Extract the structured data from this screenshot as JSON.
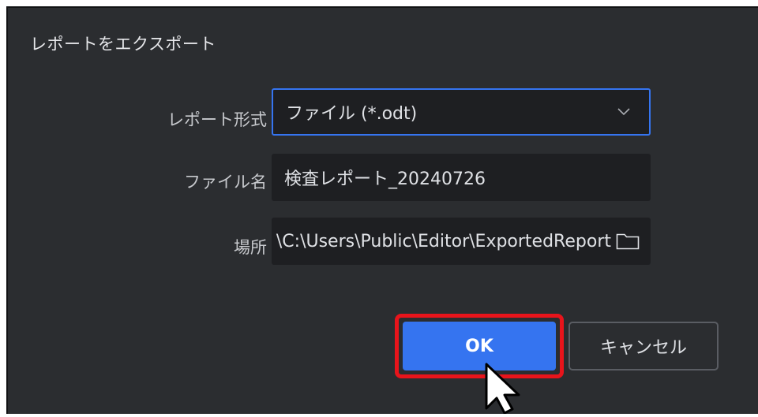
{
  "dialog": {
    "title": "レポートをエクスポート"
  },
  "form": {
    "format": {
      "label": "レポート形式",
      "value": "ファイル (*.odt)"
    },
    "filename": {
      "label": "ファイル名",
      "value": "検査レポート_20240726"
    },
    "location": {
      "label": "場所",
      "value": "C:\\Users\\Public\\Editor\\ExportedReport\\"
    }
  },
  "buttons": {
    "ok_label": "OK",
    "cancel_label": "キャンセル"
  },
  "icons": {
    "dropdown": "chevron-down-icon",
    "browse": "folder-icon",
    "pointer": "mouse-cursor-icon"
  },
  "colors": {
    "dialog_bg": "#2b2d30",
    "field_bg": "#1e1f22",
    "accent": "#3574f0",
    "highlight": "#e8141b"
  }
}
